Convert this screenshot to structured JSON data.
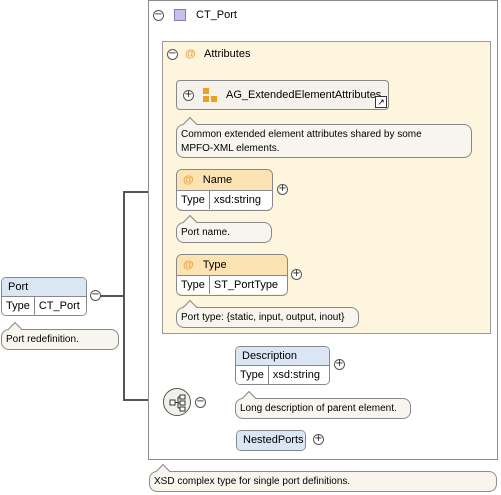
{
  "port": {
    "name": "Port",
    "type_label": "Type",
    "type_value": "CT_Port",
    "doc": "Port redefinition."
  },
  "complex_type": {
    "name": "CT_Port",
    "doc": "XSD complex type for single port definitions."
  },
  "attributes": {
    "title": "Attributes",
    "group_name": "AG_ExtendedElementAttributes",
    "group_doc_line1": "Common extended element attributes shared by some",
    "group_doc_line2": "MPFO-XML elements.",
    "items": [
      {
        "name": "Name",
        "type_label": "Type",
        "type_value": "xsd:string",
        "doc": "Port name."
      },
      {
        "name": "Type",
        "type_label": "Type",
        "type_value": "ST_PortType",
        "doc": "Port type: {static, input, output, inout}"
      }
    ]
  },
  "sequence": {
    "items": [
      {
        "name": "Description",
        "type_label": "Type",
        "type_value": "xsd:string",
        "doc": "Long description of parent element."
      },
      {
        "name": "NestedPorts"
      }
    ]
  },
  "symbols": {
    "collapse": "−",
    "expand": "+",
    "attribute_marker": "@",
    "shortcut_arrow": "↗"
  },
  "colors": {
    "element_header": "#dbe6f5",
    "attribute_header": "#fbe3b4",
    "attributes_panel": "#fdf5de",
    "note_background": "#f7f5ee",
    "complex_type_icon": "#c8c0e6",
    "group_icon": "#e8a220"
  }
}
